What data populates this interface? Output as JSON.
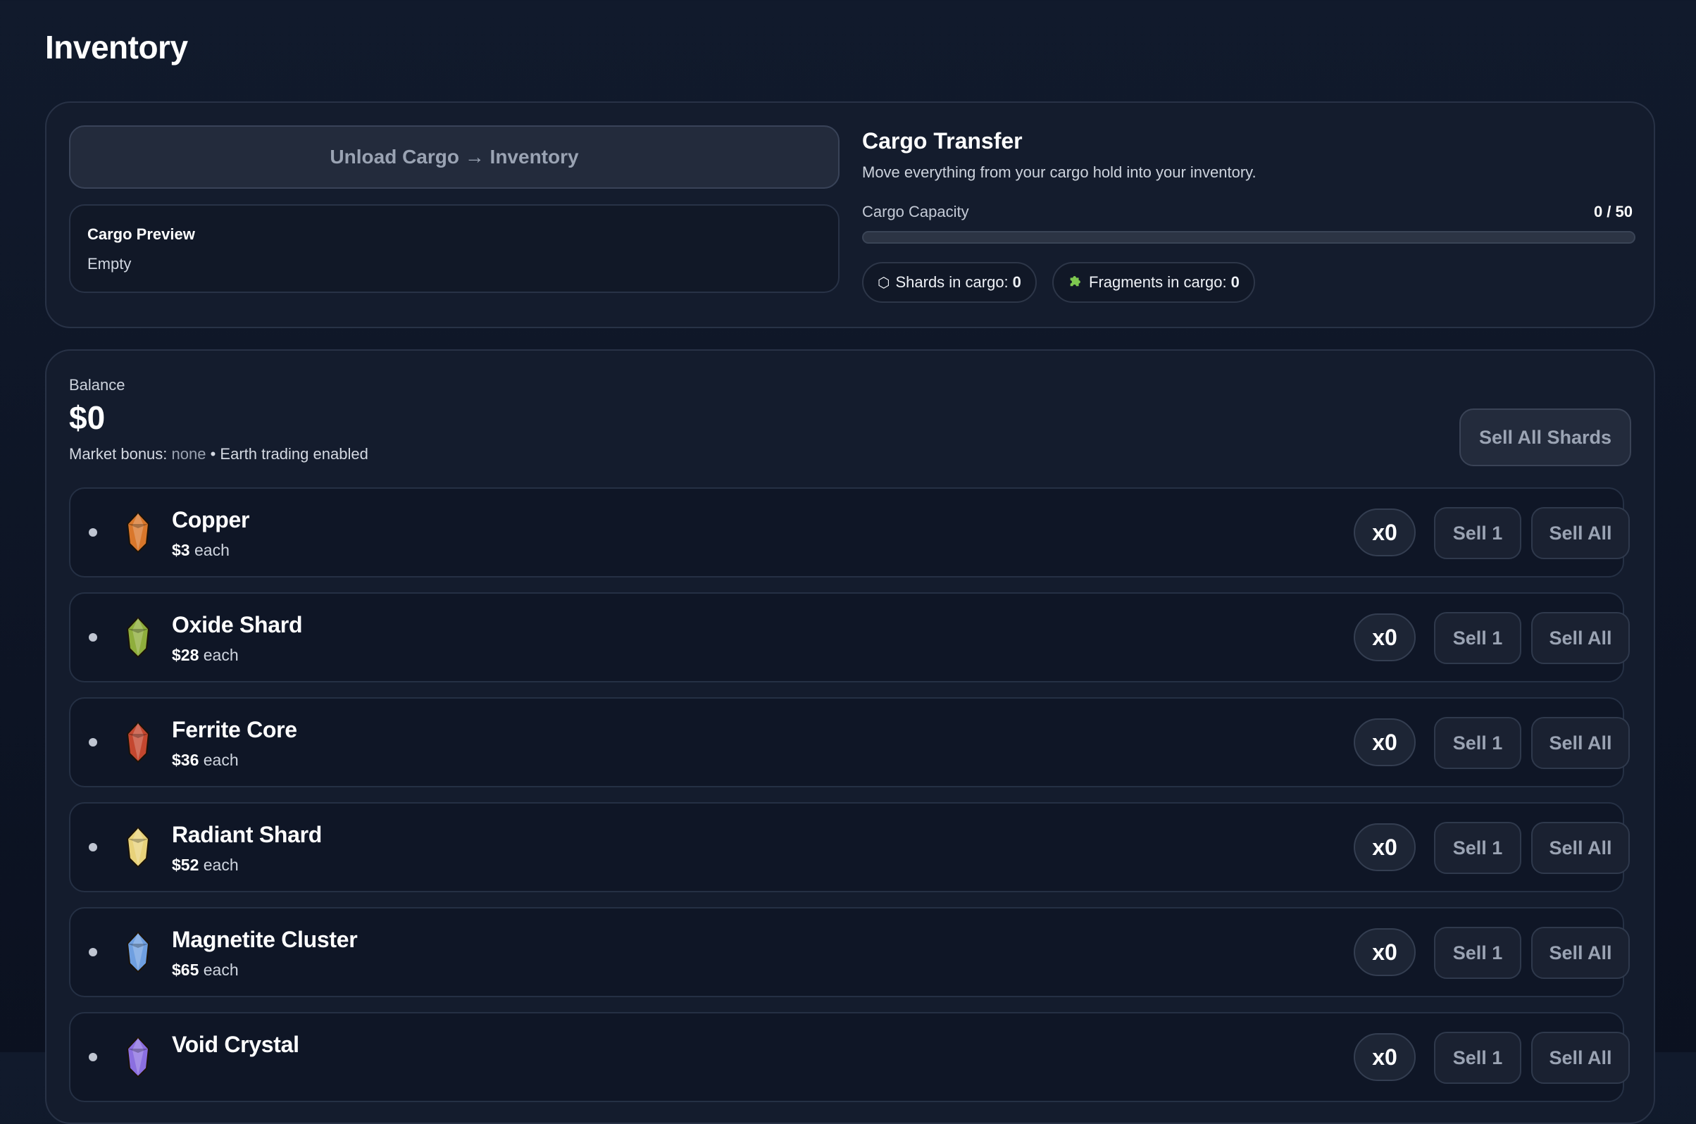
{
  "page": {
    "title": "Inventory"
  },
  "cargo": {
    "unload_label": "Unload Cargo → Inventory",
    "preview_title": "Cargo Preview",
    "preview_value": "Empty",
    "transfer_title": "Cargo Transfer",
    "transfer_desc": "Move everything from your cargo hold into your inventory.",
    "capacity_label": "Cargo Capacity",
    "capacity_text": "0 / 50",
    "capacity_fraction": 0,
    "shards_label": "Shards in cargo:",
    "shards_value": "0",
    "shards_icon": "hexagon-icon",
    "fragments_label": "Fragments in cargo:",
    "fragments_value": "0",
    "fragments_icon": "puzzle-icon"
  },
  "market": {
    "balance_label": "Balance",
    "balance_value": "$0",
    "bonus_label": "Market bonus:",
    "bonus_value": "none",
    "trading_text": "• Earth trading enabled",
    "sell_all_shards_label": "Sell All Shards"
  },
  "items": [
    {
      "name": "Copper",
      "price": "$3",
      "each": "each",
      "qty": "x0",
      "sell1": "Sell 1",
      "sellall": "Sell All",
      "color": "#d9772b",
      "icon": "copper-gem-icon"
    },
    {
      "name": "Oxide Shard",
      "price": "$28",
      "each": "each",
      "qty": "x0",
      "sell1": "Sell 1",
      "sellall": "Sell All",
      "color": "#8fae3c",
      "icon": "oxide-gem-icon"
    },
    {
      "name": "Ferrite Core",
      "price": "$36",
      "each": "each",
      "qty": "x0",
      "sell1": "Sell 1",
      "sellall": "Sell All",
      "color": "#c4472f",
      "icon": "ferrite-gem-icon"
    },
    {
      "name": "Radiant Shard",
      "price": "$52",
      "each": "each",
      "qty": "x0",
      "sell1": "Sell 1",
      "sellall": "Sell All",
      "color": "#e8d27a",
      "icon": "radiant-gem-icon"
    },
    {
      "name": "Magnetite Cluster",
      "price": "$65",
      "each": "each",
      "qty": "x0",
      "sell1": "Sell 1",
      "sellall": "Sell All",
      "color": "#6f9fe0",
      "icon": "magnetite-gem-icon"
    },
    {
      "name": "Void Crystal",
      "price": "",
      "each": "",
      "qty": "x0",
      "sell1": "Sell 1",
      "sellall": "Sell All",
      "color": "#8b6fe0",
      "icon": "void-gem-icon"
    }
  ]
}
